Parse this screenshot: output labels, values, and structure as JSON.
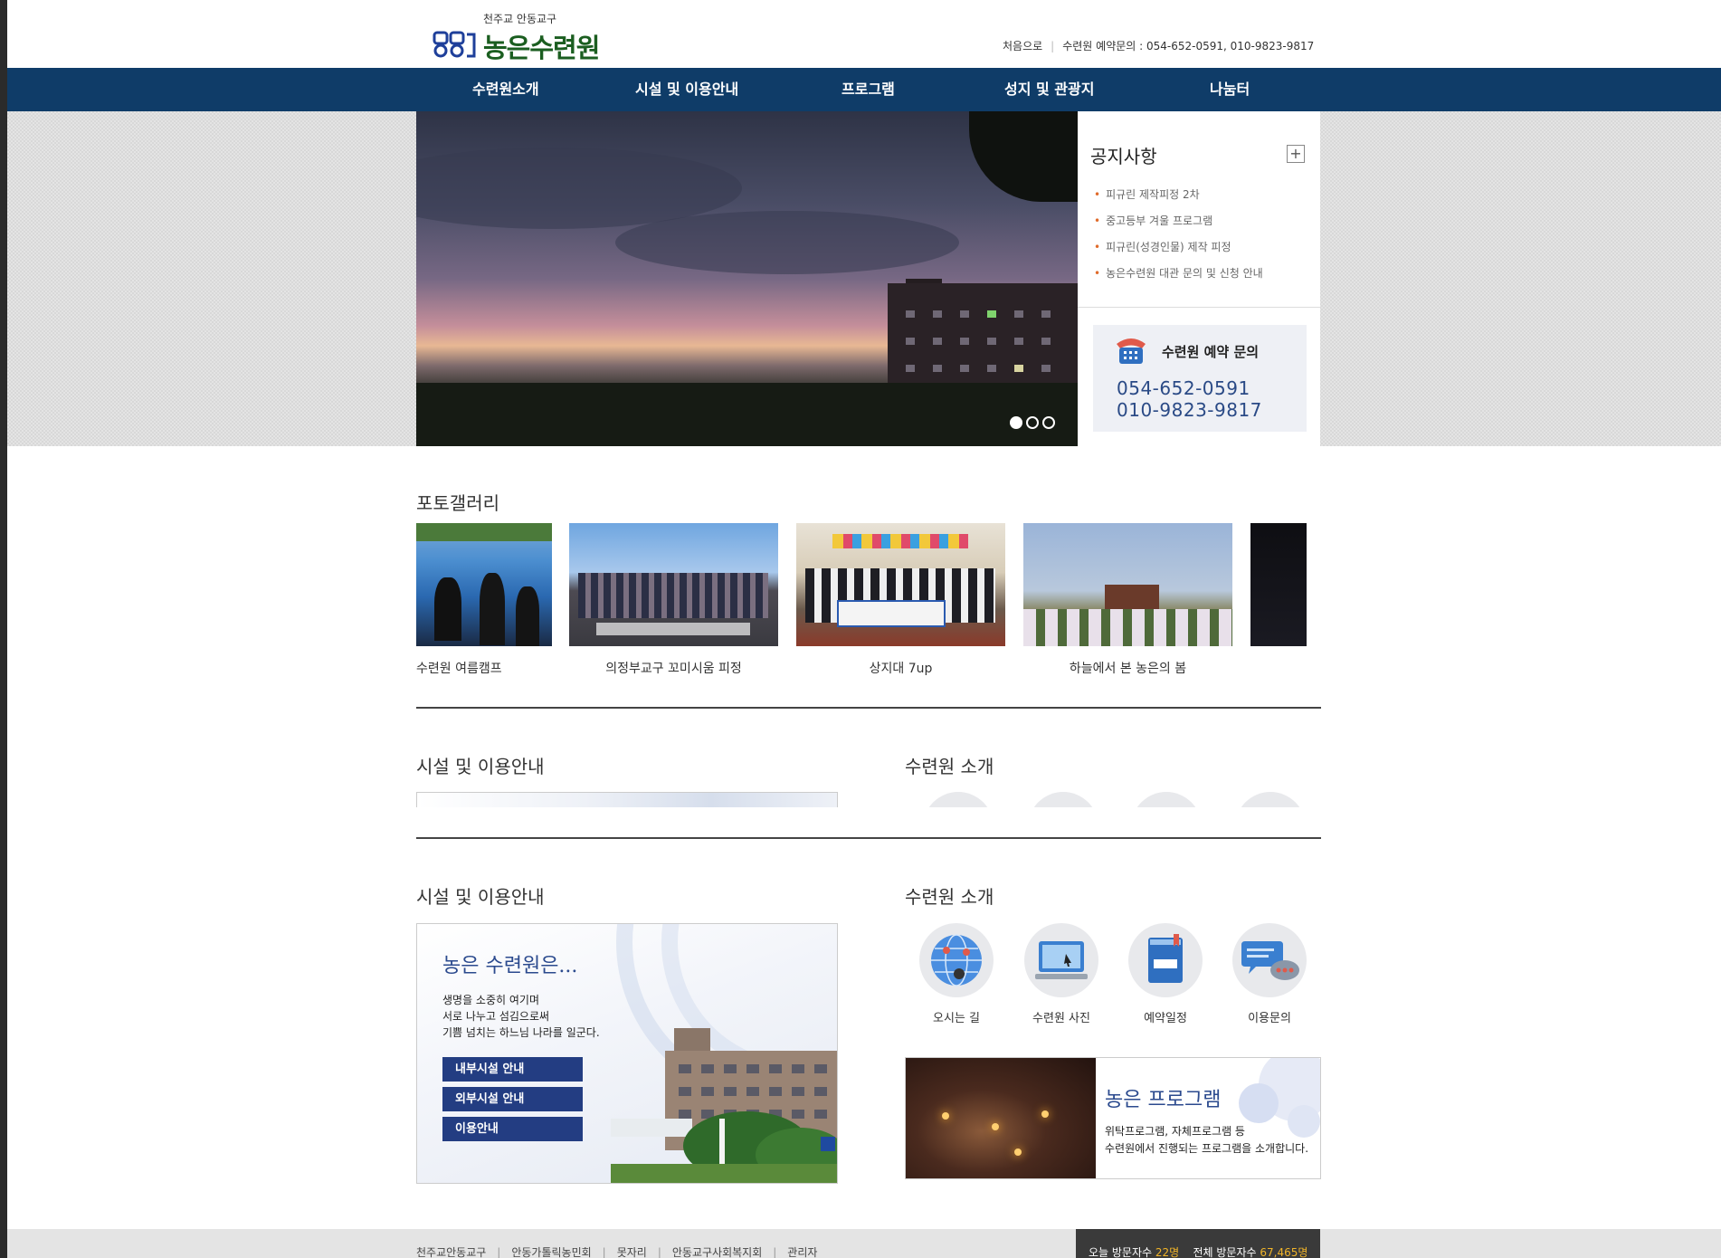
{
  "header": {
    "logo_sub": "천주교 안동교구",
    "logo_title": "농은수련원",
    "top_links": {
      "home": "처음으로",
      "contact": "수련원 예약문의 : 054-652-0591, 010-9823-9817"
    }
  },
  "nav": [
    "수련원소개",
    "시설 및 이용안내",
    "프로그램",
    "성지 및 관광지",
    "나눔터"
  ],
  "notice": {
    "title": "공지사항",
    "more": "+",
    "items": [
      "피규린 제작피정 2차",
      "중고등부 겨울 프로그램",
      "피규린(성경인물) 제작 피정",
      "농은수련원 대관 문의 및 신청 안내"
    ]
  },
  "reserve": {
    "title": "수련원 예약 문의",
    "phone1": "054-652-0591",
    "phone2": "010-9823-9817"
  },
  "gallery": {
    "title": "포토갤러리",
    "items": [
      "수련원 여름캠프",
      "의정부교구 꼬미시움 피정",
      "상지대 7up",
      "하늘에서 본 농은의 봄",
      ""
    ]
  },
  "facility": {
    "title": "시설 및 이용안내",
    "heading": "농은 수련원은...",
    "lines": [
      "생명을 소중히 여기며",
      "서로 나누고 섬김으로써",
      "기쁨 넘치는 하느님 나라를 일군다."
    ],
    "buttons": [
      "내부시설 안내",
      "외부시설 안내",
      "이용안내"
    ]
  },
  "intro": {
    "title": "수련원 소개",
    "icons": [
      {
        "label": "오시는 길",
        "icon": "globe-icon"
      },
      {
        "label": "수련원 사진",
        "icon": "monitor-icon"
      },
      {
        "label": "예약일정",
        "icon": "book-icon"
      },
      {
        "label": "이용문의",
        "icon": "chat-icon"
      }
    ]
  },
  "program": {
    "heading": "농은 프로그램",
    "lines": [
      "위탁프로그램, 자체프로그램 등",
      "수련원에서 진행되는 프로그램을 소개합니다."
    ]
  },
  "footer": {
    "links": [
      "천주교안동교구",
      "안동가톨릭농민회",
      "못자리",
      "안동교구사회복지회",
      "관리자"
    ],
    "visitor": {
      "today_label": "오늘 방문자수",
      "today": "22명",
      "total_label": "전체 방문자수",
      "total": "67,465명"
    }
  },
  "colors": {
    "nav": "#0f3c68",
    "accent": "#233d82",
    "bullet": "#e06b2b"
  }
}
